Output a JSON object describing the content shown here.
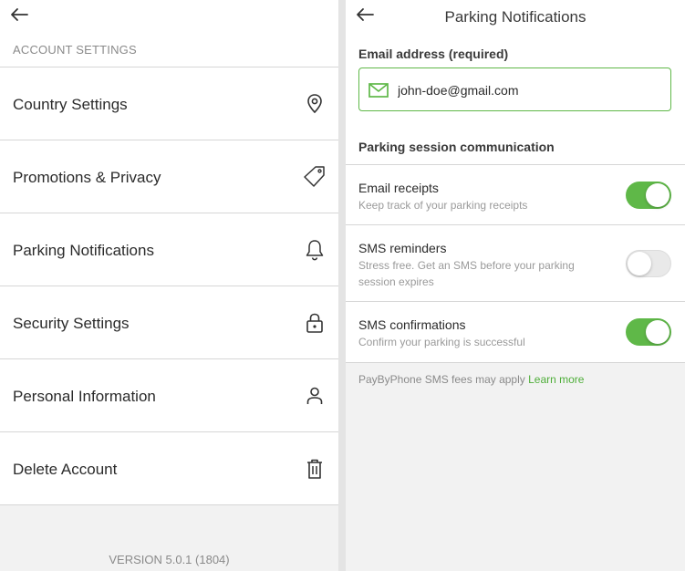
{
  "left": {
    "section_label": "ACCOUNT SETTINGS",
    "items": [
      {
        "label": "Country Settings",
        "icon": "location-pin-icon"
      },
      {
        "label": "Promotions & Privacy",
        "icon": "tag-icon"
      },
      {
        "label": "Parking Notifications",
        "icon": "bell-icon"
      },
      {
        "label": "Security Settings",
        "icon": "lock-icon"
      },
      {
        "label": "Personal Information",
        "icon": "person-icon"
      },
      {
        "label": "Delete Account",
        "icon": "trash-icon"
      }
    ],
    "version": "VERSION 5.0.1 (1804)"
  },
  "right": {
    "title": "Parking Notifications",
    "email_label": "Email address (required)",
    "email_value": "john-doe@gmail.com",
    "section_header": "Parking session communication",
    "toggles": [
      {
        "title": "Email receipts",
        "desc": "Keep track of your parking receipts",
        "on": true
      },
      {
        "title": "SMS reminders",
        "desc": "Stress free. Get an SMS before your parking session expires",
        "on": false
      },
      {
        "title": "SMS confirmations",
        "desc": "Confirm your parking is successful",
        "on": true
      }
    ],
    "fees_text": "PayByPhone SMS fees may apply",
    "learn_more": "Learn more"
  },
  "colors": {
    "accent": "#5fb848",
    "link": "#4fae3a",
    "divider": "#d6d6d6",
    "background": "#f2f2f2"
  }
}
